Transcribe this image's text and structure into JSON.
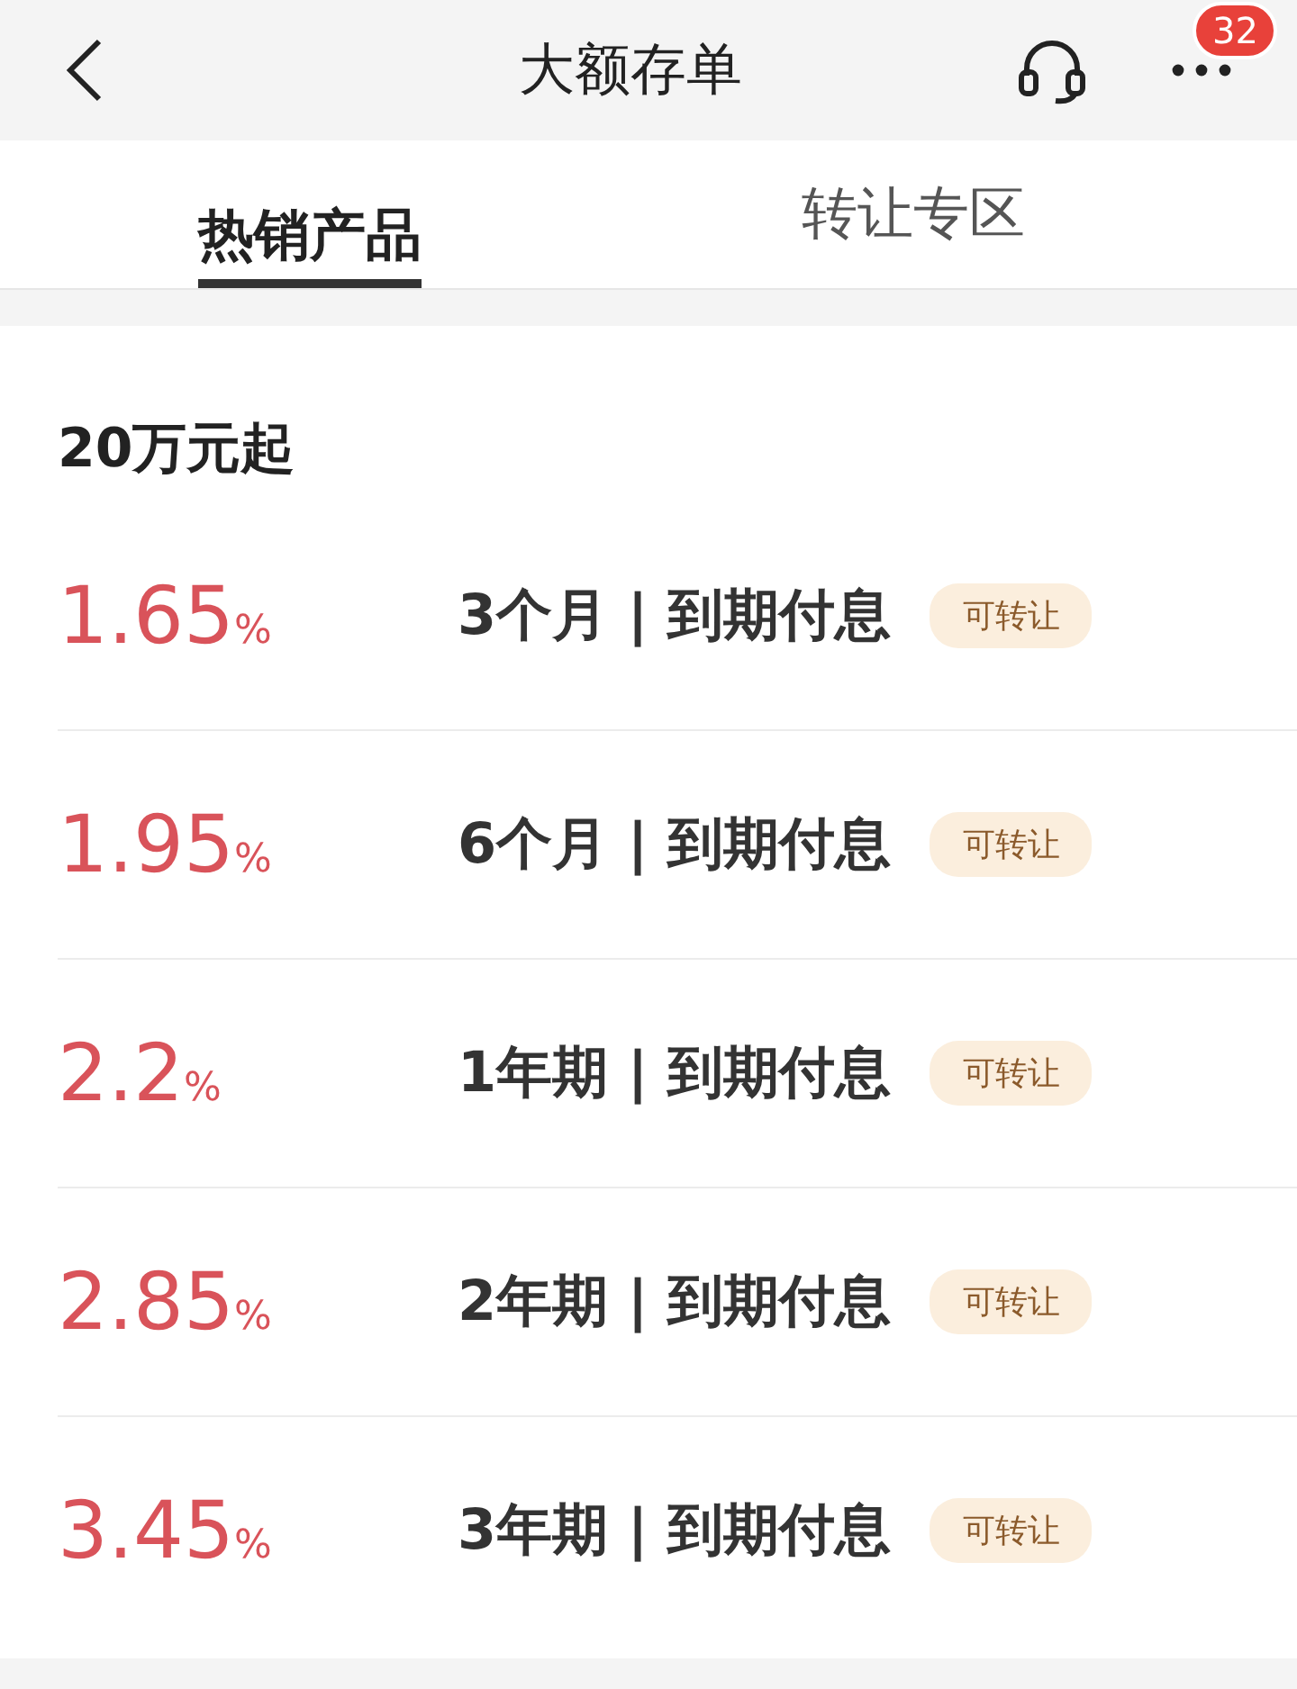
{
  "header": {
    "title": "大额存单",
    "message_count": "32"
  },
  "tabs": [
    {
      "label": "热销产品",
      "selected": true
    },
    {
      "label": "转让专区",
      "selected": false
    }
  ],
  "section_title": "20万元起",
  "products": [
    {
      "rate": "1.65",
      "unit": "%",
      "term": "3个月 | 到期付息",
      "tag": "可转让"
    },
    {
      "rate": "1.95",
      "unit": "%",
      "term": "6个月 | 到期付息",
      "tag": "可转让"
    },
    {
      "rate": "2.2",
      "unit": "%",
      "term": "1年期 | 到期付息",
      "tag": "可转让"
    },
    {
      "rate": "2.85",
      "unit": "%",
      "term": "2年期 | 到期付息",
      "tag": "可转让"
    },
    {
      "rate": "3.45",
      "unit": "%",
      "term": "3年期 | 到期付息",
      "tag": "可转让"
    }
  ]
}
